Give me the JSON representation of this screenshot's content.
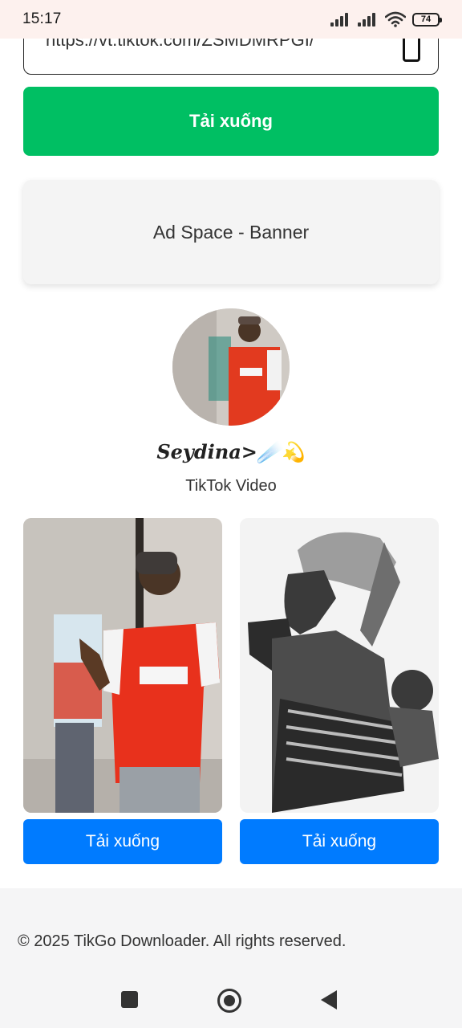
{
  "status_bar": {
    "time": "15:17",
    "battery": "74"
  },
  "url_input": {
    "value": "https://vt.tiktok.com/ZSMDMRPGI/"
  },
  "main_download_label": "Tải xuống",
  "ad_banner": "Ad Space - Banner",
  "profile": {
    "username": "𝑺𝒆𝒚𝒅𝒊𝒏𝒂>☄️💫",
    "subtitle": "TikTok Video"
  },
  "media": [
    {
      "button_label": "Tải xuống"
    },
    {
      "button_label": "Tải xuống"
    }
  ],
  "footer": {
    "copyright": "© 2025 TikGo Downloader. All rights reserved."
  },
  "colors": {
    "primary_green": "#00bf63",
    "primary_blue": "#007bff"
  }
}
